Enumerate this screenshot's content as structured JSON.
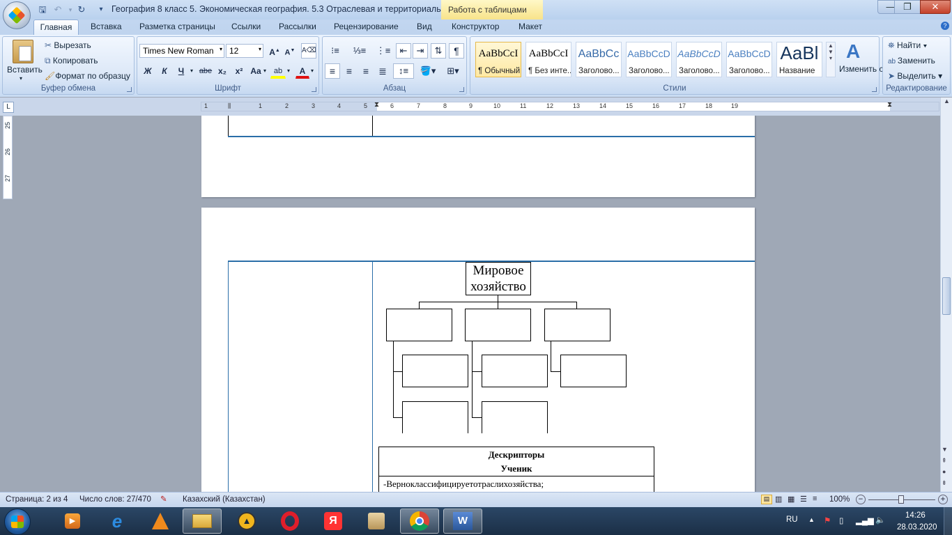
{
  "window": {
    "title": "География 8 класс 5. Экономическая география. 5.3 Отраслевая и территориальн...",
    "contextual_tab": "Работа с таблицами"
  },
  "tabs": [
    "Главная",
    "Вставка",
    "Разметка страницы",
    "Ссылки",
    "Рассылки",
    "Рецензирование",
    "Вид",
    "Конструктор",
    "Макет"
  ],
  "clipboard": {
    "paste": "Вставить",
    "cut": "Вырезать",
    "copy": "Копировать",
    "format_painter": "Формат по образцу",
    "label": "Буфер обмена"
  },
  "font": {
    "name": "Times New Roman",
    "size": "12",
    "label": "Шрифт",
    "bold": "Ж",
    "italic": "К",
    "underline": "Ч",
    "strike": "abe",
    "sub": "x₂",
    "sup": "x²",
    "case": "Aa"
  },
  "paragraph": {
    "label": "Абзац"
  },
  "styles": {
    "label": "Стили",
    "change": "Изменить стили",
    "items": [
      {
        "sample": "AaBbCcI",
        "name": "¶ Обычный"
      },
      {
        "sample": "AaBbCcI",
        "name": "¶ Без инте..."
      },
      {
        "sample": "AaBbCc",
        "name": "Заголово..."
      },
      {
        "sample": "AaBbCcD",
        "name": "Заголово..."
      },
      {
        "sample": "AaBbCcD",
        "name": "Заголово..."
      },
      {
        "sample": "AaBbCcD",
        "name": "Заголово..."
      },
      {
        "sample": "AaBl",
        "name": "Название"
      }
    ]
  },
  "editing": {
    "label": "Редактирование",
    "find": "Найти",
    "replace": "Заменить",
    "select": "Выделить"
  },
  "ruler": {
    "marks": [
      "1",
      "2",
      "1",
      "2",
      "3",
      "4",
      "5",
      "6",
      "7",
      "8",
      "9",
      "10",
      "11",
      "12",
      "13",
      "14",
      "15",
      "16",
      "17",
      "18",
      "19"
    ],
    "vmarks": [
      "25",
      "26",
      "27"
    ]
  },
  "document": {
    "diagram_root": "Мировое хозяйство",
    "table_header1": "Дескрипторы",
    "table_header2": "Ученик",
    "table_row1": "-Верноклассифицируетотраслихозяйства;"
  },
  "status": {
    "page": "Страница: 2 из 4",
    "words": "Число слов: 27/470",
    "language": "Казахский (Казахстан)",
    "zoom": "100%"
  },
  "taskbar": {
    "lang": "RU",
    "time": "14:26",
    "date": "28.03.2020"
  }
}
